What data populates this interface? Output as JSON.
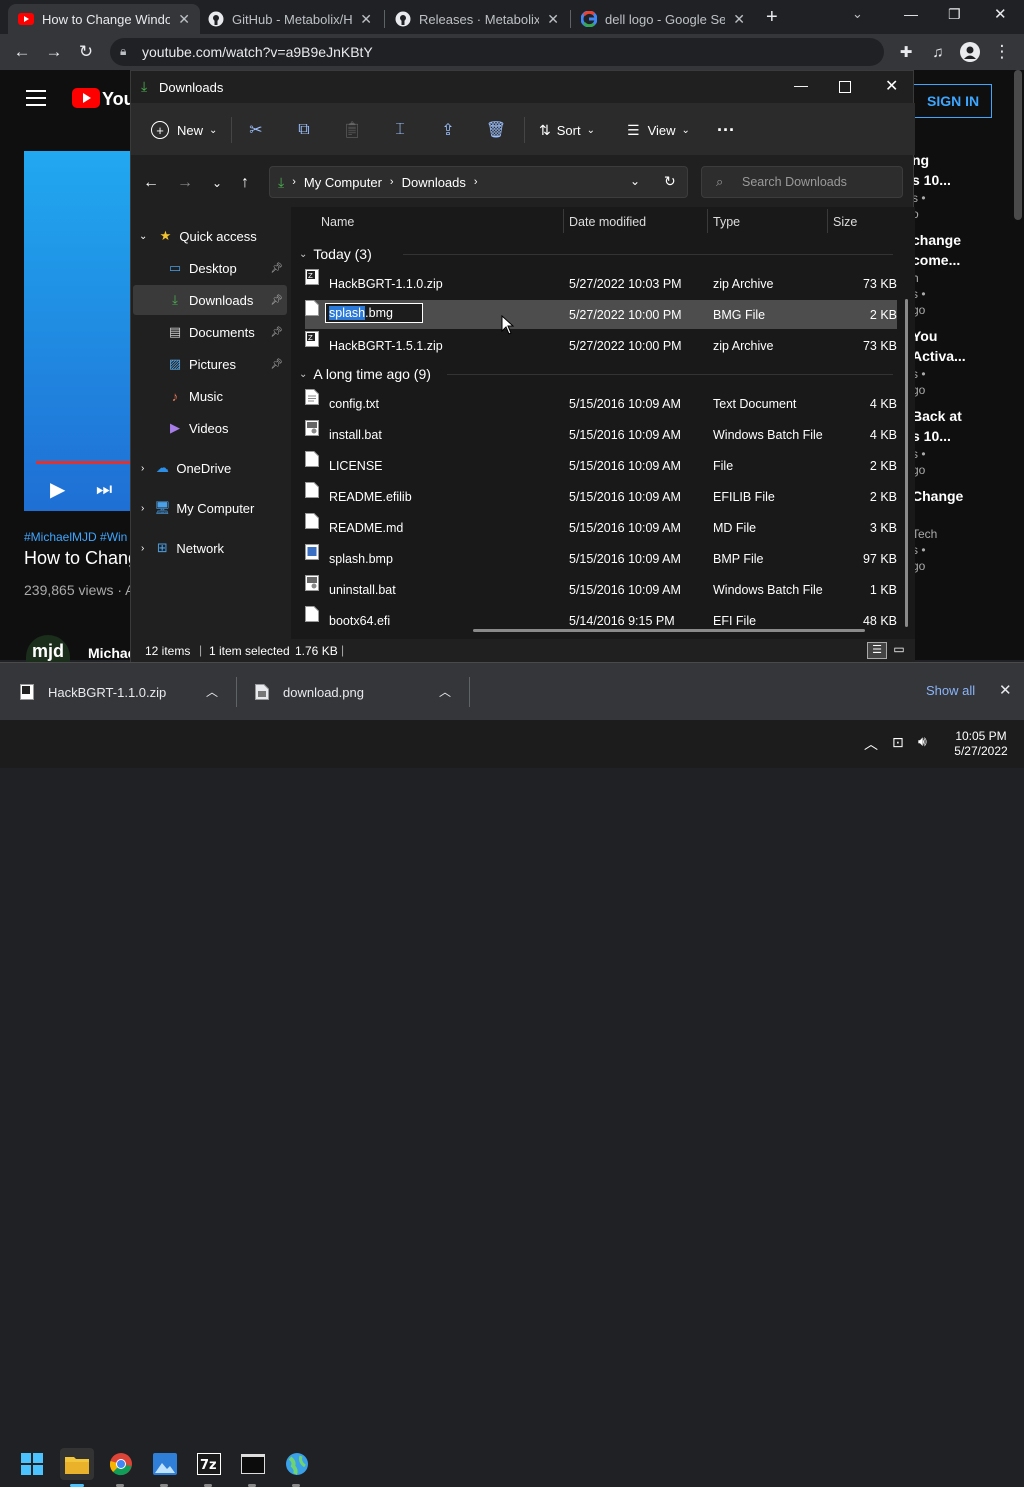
{
  "browser": {
    "tabs": [
      {
        "title": "How to Change Windo",
        "icon": "youtube-icon",
        "active": true
      },
      {
        "title": "GitHub - Metabolix/Ha",
        "icon": "github-icon"
      },
      {
        "title": "Releases · Metabolix/H",
        "icon": "github-icon"
      },
      {
        "title": "dell logo - Google Sea",
        "icon": "google-icon"
      }
    ],
    "new_tab": "+",
    "url": "youtube.com/watch?v=a9B9eJnKBtY"
  },
  "youtube": {
    "signin": "SIGN IN",
    "hashtags": "#MichaelMJD #Win",
    "video_title": "How to Chang",
    "views": "239,865 views · A",
    "channel": "Michae",
    "avatar_text": "mjd",
    "side_texts": [
      "ng",
      "s 10...",
      "s •",
      "o",
      "change",
      "come...",
      "h",
      "s •",
      "go",
      "You",
      "Activa...",
      "s •",
      "go",
      "Back at",
      "s 10...",
      "s •",
      "go",
      "Change",
      "Tech",
      "s •",
      "go"
    ]
  },
  "explorer": {
    "title": "Downloads",
    "cmd": {
      "new": "New",
      "sort": "Sort",
      "view": "View",
      "more": "···"
    },
    "address": {
      "parts": [
        "My Computer",
        "Downloads"
      ]
    },
    "search_placeholder": "Search Downloads",
    "nav": [
      {
        "label": "Quick access",
        "icon": "star-icon"
      },
      {
        "label": "Desktop",
        "icon": "desktop-icon"
      },
      {
        "label": "Downloads",
        "icon": "download-icon"
      },
      {
        "label": "Documents",
        "icon": "documents-icon"
      },
      {
        "label": "Pictures",
        "icon": "pictures-icon"
      },
      {
        "label": "Music",
        "icon": "music-icon"
      },
      {
        "label": "Videos",
        "icon": "videos-icon"
      },
      {
        "label": "OneDrive",
        "icon": "cloud-icon"
      },
      {
        "label": "My Computer",
        "icon": "computer-icon"
      },
      {
        "label": "Network",
        "icon": "network-icon"
      }
    ],
    "columns": {
      "name": "Name",
      "date": "Date modified",
      "type": "Type",
      "size": "Size"
    },
    "groups": [
      {
        "label": "Today (3)"
      },
      {
        "label": "A long time ago (9)"
      }
    ],
    "rename_value_selected": "splash",
    "rename_value_rest": ".bmg",
    "files": [
      {
        "name": "HackBGRT-1.1.0.zip",
        "date": "5/27/2022 10:03 PM",
        "type": "zip Archive",
        "size": "73 KB",
        "kind": "zip"
      },
      {
        "name": "splash.bmg",
        "date": "5/27/2022 10:00 PM",
        "type": "BMG File",
        "size": "2 KB",
        "kind": "file"
      },
      {
        "name": "HackBGRT-1.5.1.zip",
        "date": "5/27/2022 10:00 PM",
        "type": "zip Archive",
        "size": "73 KB",
        "kind": "zip"
      },
      {
        "name": "config.txt",
        "date": "5/15/2016 10:09 AM",
        "type": "Text Document",
        "size": "4 KB",
        "kind": "file"
      },
      {
        "name": "install.bat",
        "date": "5/15/2016 10:09 AM",
        "type": "Windows Batch File",
        "size": "4 KB",
        "kind": "bat"
      },
      {
        "name": "LICENSE",
        "date": "5/15/2016 10:09 AM",
        "type": "File",
        "size": "2 KB",
        "kind": "file"
      },
      {
        "name": "README.efilib",
        "date": "5/15/2016 10:09 AM",
        "type": "EFILIB File",
        "size": "2 KB",
        "kind": "file"
      },
      {
        "name": "README.md",
        "date": "5/15/2016 10:09 AM",
        "type": "MD File",
        "size": "3 KB",
        "kind": "file"
      },
      {
        "name": "splash.bmp",
        "date": "5/15/2016 10:09 AM",
        "type": "BMP File",
        "size": "97 KB",
        "kind": "bmp"
      },
      {
        "name": "uninstall.bat",
        "date": "5/15/2016 10:09 AM",
        "type": "Windows Batch File",
        "size": "1 KB",
        "kind": "bat"
      },
      {
        "name": "bootx64.efi",
        "date": "5/14/2016 9:15 PM",
        "type": "EFI File",
        "size": "48 KB",
        "kind": "file"
      }
    ],
    "status": {
      "count": "12 items",
      "selected": "1 item selected",
      "size": "1.76 KB"
    }
  },
  "downloads_shelf": {
    "items": [
      {
        "name": "HackBGRT-1.1.0.zip"
      },
      {
        "name": "download.png"
      }
    ],
    "show_all": "Show all"
  },
  "taskbar": {
    "time": "10:05 PM",
    "date": "5/27/2022"
  }
}
